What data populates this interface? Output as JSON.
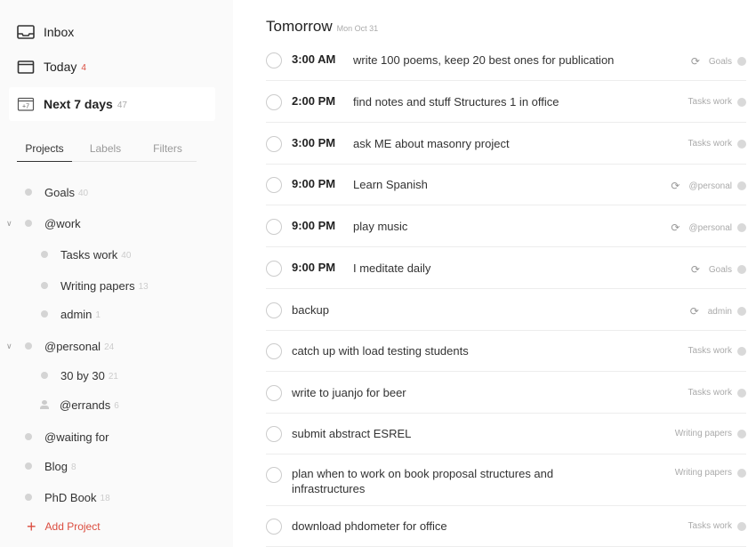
{
  "sidebar": {
    "top": [
      {
        "label": "Inbox",
        "count": ""
      },
      {
        "label": "Today",
        "count": "4"
      },
      {
        "label": "Next 7 days",
        "count": "47"
      }
    ],
    "tabs": [
      "Projects",
      "Labels",
      "Filters"
    ],
    "projects": [
      {
        "label": "Goals",
        "count": "40"
      },
      {
        "label": "@work",
        "count": ""
      },
      {
        "label": "Tasks work",
        "count": "40"
      },
      {
        "label": "Writing papers",
        "count": "13"
      },
      {
        "label": "admin",
        "count": "1"
      },
      {
        "label": "@personal",
        "count": "24"
      },
      {
        "label": "30 by 30",
        "count": "21"
      },
      {
        "label": "@errands",
        "count": "6"
      },
      {
        "label": "@waiting for",
        "count": ""
      },
      {
        "label": "Blog",
        "count": "8"
      },
      {
        "label": "PhD Book",
        "count": "18"
      }
    ],
    "add_project": "Add Project",
    "next7_icon_text": "+7"
  },
  "main": {
    "title": "Tomorrow",
    "date": "Mon Oct 31",
    "tasks": [
      {
        "time": "3:00 AM",
        "text": "write 100 poems, keep 20 best ones for publication",
        "project": "Goals"
      },
      {
        "time": "2:00 PM",
        "text": "find notes and stuff Structures 1 in office",
        "project": "Tasks work"
      },
      {
        "time": "3:00 PM",
        "text": "ask ME about masonry project",
        "project": "Tasks work"
      },
      {
        "time": "9:00 PM",
        "text": "Learn Spanish",
        "project": "@personal"
      },
      {
        "time": "9:00 PM",
        "text": "play music",
        "project": "@personal"
      },
      {
        "time": "9:00 PM",
        "text": "I meditate daily",
        "project": "Goals"
      },
      {
        "time": "",
        "text": "backup",
        "project": "admin"
      },
      {
        "time": "",
        "text": "catch up with load testing students",
        "project": "Tasks work"
      },
      {
        "time": "",
        "text": "write to juanjo for beer",
        "project": "Tasks work"
      },
      {
        "time": "",
        "text": "submit abstract ESREL",
        "project": "Writing papers"
      },
      {
        "time": "",
        "text": "plan when to work on book proposal structures and infrastructures",
        "project": "Writing papers"
      },
      {
        "time": "",
        "text": "download phdometer for office",
        "project": "Tasks work"
      }
    ],
    "repeat_symbol": "⟳"
  },
  "colors": {
    "accent": "#db4c3f",
    "dot": "#d4d4d4"
  }
}
